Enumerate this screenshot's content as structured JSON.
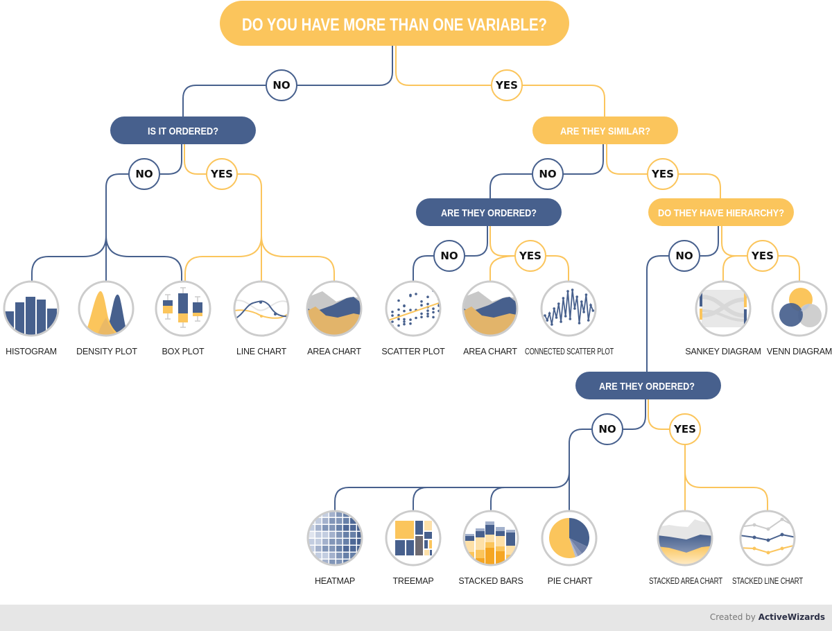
{
  "colors": {
    "blue": "#47608d",
    "yellow": "#fbc55c",
    "ring": "#cccccc",
    "label": "#222222",
    "footer_bg": "#e6e6e6"
  },
  "questions": {
    "root": "DO YOU HAVE MORE THAN ONE VARIABLE?",
    "is_it_ordered": "IS IT ORDERED?",
    "are_they_similar": "ARE THEY SIMILAR?",
    "are_they_ordered_1": "ARE THEY ORDERED?",
    "do_they_have_hierarchy": "DO THEY HAVE HIERARCHY?",
    "are_they_ordered_2": "ARE THEY ORDERED?"
  },
  "answers": {
    "no": "NO",
    "yes": "YES"
  },
  "charts": [
    {
      "id": "histogram",
      "label": "HISTOGRAM"
    },
    {
      "id": "density",
      "label": "DENSITY PLOT"
    },
    {
      "id": "boxplot",
      "label": "BOX PLOT"
    },
    {
      "id": "linechart",
      "label": "LINE CHART"
    },
    {
      "id": "areachart1",
      "label": "AREA CHART"
    },
    {
      "id": "scatter",
      "label": "SCATTER PLOT"
    },
    {
      "id": "areachart2",
      "label": "AREA CHART"
    },
    {
      "id": "connscatter",
      "label": "CONNECTED SCATTER PLOT"
    },
    {
      "id": "sankey",
      "label": "SANKEY DIAGRAM"
    },
    {
      "id": "venn",
      "label": "VENN DIAGRAM"
    },
    {
      "id": "heatmap",
      "label": "HEATMAP"
    },
    {
      "id": "treemap",
      "label": "TREEMAP"
    },
    {
      "id": "stackedbars",
      "label": "STACKED BARS"
    },
    {
      "id": "piechart",
      "label": "PIE CHART"
    },
    {
      "id": "stackedarea",
      "label": "STACKED AREA CHART"
    },
    {
      "id": "stackedline",
      "label": "STACKED LINE CHART"
    }
  ],
  "footer": {
    "prefix": "Created by ",
    "brand": "ActiveWizards"
  }
}
